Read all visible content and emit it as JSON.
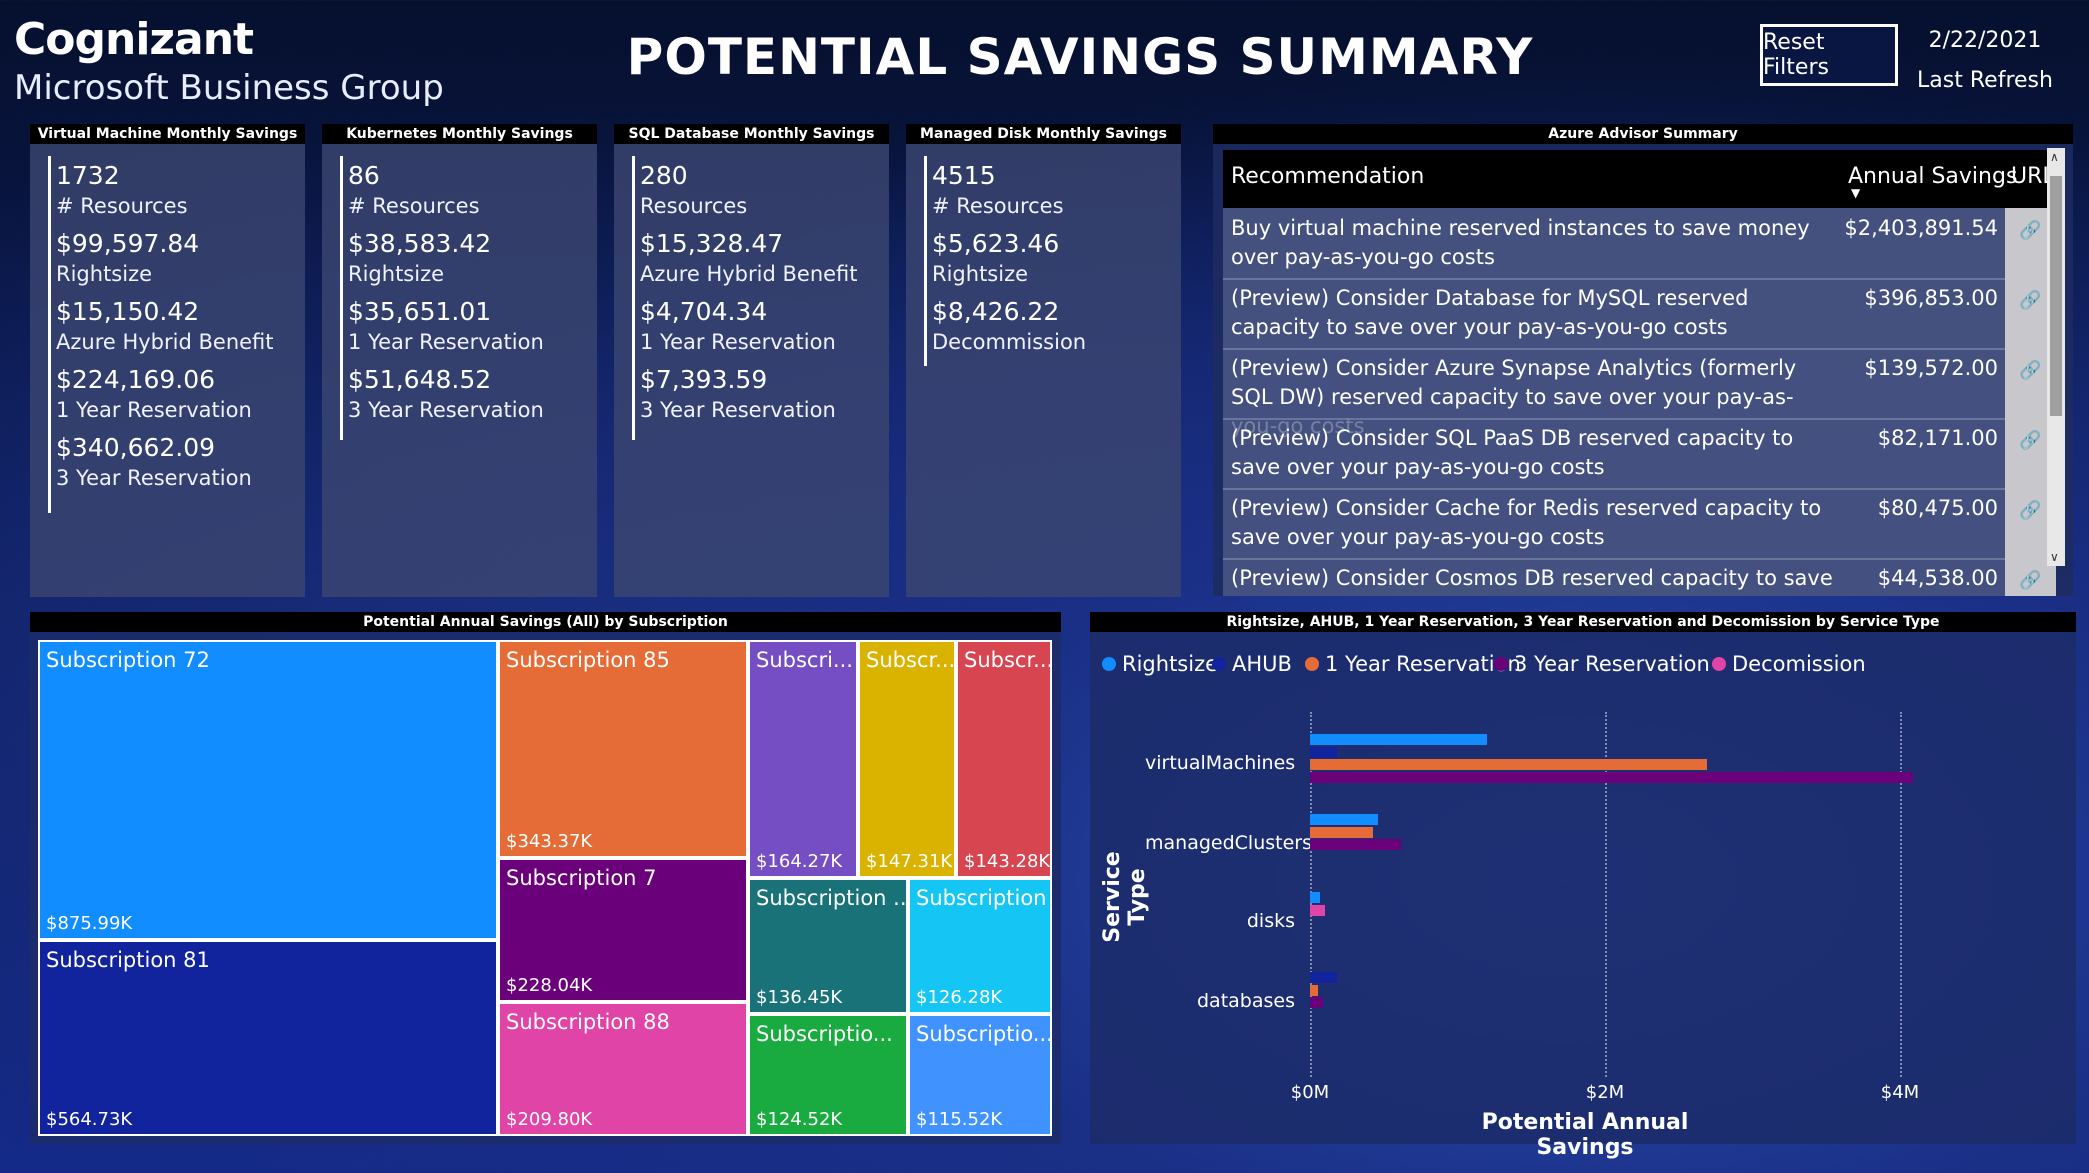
{
  "header": {
    "logo_main": "Cognizant",
    "logo_sub": "Microsoft Business Group",
    "title": "POTENTIAL SAVINGS SUMMARY",
    "reset_label": "Reset Filters",
    "refresh_date": "2/22/2021",
    "refresh_label": "Last Refresh"
  },
  "cards": [
    {
      "title": "Virtual Machine Monthly Savings",
      "items": [
        {
          "value": "1732",
          "label": "# Resources"
        },
        {
          "value": "$99,597.84",
          "label": "Rightsize"
        },
        {
          "value": "$15,150.42",
          "label": "Azure Hybrid Benefit"
        },
        {
          "value": "$224,169.06",
          "label": "1 Year Reservation"
        },
        {
          "value": "$340,662.09",
          "label": "3 Year Reservation"
        }
      ]
    },
    {
      "title": "Kubernetes Monthly Savings",
      "items": [
        {
          "value": "86",
          "label": "# Resources"
        },
        {
          "value": "$38,583.42",
          "label": "Rightsize"
        },
        {
          "value": "$35,651.01",
          "label": "1 Year Reservation"
        },
        {
          "value": "$51,648.52",
          "label": "3 Year Reservation"
        }
      ]
    },
    {
      "title": "SQL Database Monthly Savings",
      "items": [
        {
          "value": "280",
          "label": "Resources"
        },
        {
          "value": "$15,328.47",
          "label": "Azure Hybrid Benefit"
        },
        {
          "value": "$4,704.34",
          "label": "1 Year Reservation"
        },
        {
          "value": "$7,393.59",
          "label": "3 Year Reservation"
        }
      ]
    },
    {
      "title": "Managed Disk Monthly Savings",
      "items": [
        {
          "value": "4515",
          "label": "# Resources"
        },
        {
          "value": "$5,623.46",
          "label": "Rightsize"
        },
        {
          "value": "$8,426.22",
          "label": "Decommission"
        }
      ]
    }
  ],
  "advisor": {
    "title": "Azure Advisor Summary",
    "columns": [
      "Recommendation",
      "Annual Savings",
      "URL"
    ],
    "rows": [
      {
        "recommendation": "Buy virtual machine reserved instances to save money over pay-as-you-go costs",
        "savings": "$2,403,891.54"
      },
      {
        "recommendation": "(Preview) Consider Database for MySQL reserved capacity to save over your pay-as-you-go costs",
        "savings": "$396,853.00"
      },
      {
        "recommendation": "(Preview) Consider Azure Synapse Analytics (formerly SQL DW) reserved capacity to save over your pay-as-you-go costs",
        "savings": "$139,572.00"
      },
      {
        "recommendation": "(Preview) Consider SQL PaaS DB reserved capacity to save over your pay-as-you-go costs",
        "savings": "$82,171.00"
      },
      {
        "recommendation": "(Preview) Consider Cache for Redis reserved capacity to save over your pay-as-you-go costs",
        "savings": "$80,475.00"
      },
      {
        "recommendation": "(Preview) Consider Cosmos DB reserved capacity to save over",
        "savings": "$44,538.00"
      }
    ],
    "url_icon": "link-icon"
  },
  "treemap": {
    "title": "Potential Annual Savings (All) by Subscription",
    "tiles": [
      {
        "name": "Subscription 72",
        "value": "$875.99K",
        "color": "#118dff"
      },
      {
        "name": "Subscription 81",
        "value": "$564.73K",
        "color": "#12239e"
      },
      {
        "name": "Subscription 85",
        "value": "$343.37K",
        "color": "#e66c37"
      },
      {
        "name": "Subscription 7",
        "value": "$228.04K",
        "color": "#6b007b"
      },
      {
        "name": "Subscription 88",
        "value": "$209.80K",
        "color": "#e044a7"
      },
      {
        "name": "Subscri...",
        "value": "$164.27K",
        "color": "#744ec2"
      },
      {
        "name": "Subscr...",
        "value": "$147.31K",
        "color": "#d9b300"
      },
      {
        "name": "Subscr...",
        "value": "$143.28K",
        "color": "#d64550"
      },
      {
        "name": "Subscription ...",
        "value": "$136.45K",
        "color": "#197278"
      },
      {
        "name": "Subscriptio...",
        "value": "$124.52K",
        "color": "#1aab40"
      },
      {
        "name": "Subscription ...",
        "value": "$126.28K",
        "color": "#15c6f4"
      },
      {
        "name": "Subscriptio...",
        "value": "$115.52K",
        "color": "#4092ff"
      }
    ]
  },
  "bar_chart": {
    "title": "Rightsize, AHUB, 1 Year Reservation, 3 Year Reservation and Decomission by Service Type",
    "xlabel": "Potential Annual Savings",
    "ylabel": "Service Type"
  },
  "chart_data": {
    "type": "bar",
    "orientation": "horizontal",
    "categories": [
      "virtualMachines",
      "managedClusters",
      "disks",
      "databases"
    ],
    "series": [
      {
        "name": "Rightsize",
        "color": "#118dff",
        "values": [
          1200000,
          460000,
          67000,
          0
        ]
      },
      {
        "name": "AHUB",
        "color": "#12239e",
        "values": [
          182000,
          0,
          0,
          184000
        ]
      },
      {
        "name": "1 Year Reservation",
        "color": "#e66c37",
        "values": [
          2690000,
          428000,
          0,
          56000
        ]
      },
      {
        "name": "3 Year Reservation",
        "color": "#6b007b",
        "values": [
          4090000,
          620000,
          0,
          89000
        ]
      },
      {
        "name": "Decomission",
        "color": "#e044a7",
        "values": [
          0,
          0,
          101000,
          0
        ]
      }
    ],
    "xticks": [
      "$0M",
      "$2M",
      "$4M"
    ],
    "xlim": [
      0,
      5000000
    ],
    "legend": "top-left",
    "grid": true
  }
}
